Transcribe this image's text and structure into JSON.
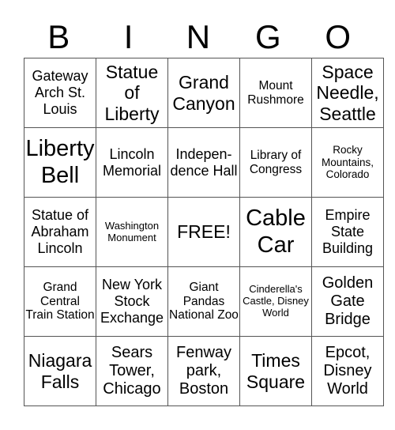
{
  "header": {
    "letters": [
      "B",
      "I",
      "N",
      "G",
      "O"
    ]
  },
  "grid": {
    "rows": [
      [
        "Gateway Arch St. Louis",
        "Statue of Liberty",
        "Grand Canyon",
        "Mount Rushmore",
        "Space Needle, Seattle"
      ],
      [
        "Liberty Bell",
        "Lincoln Memorial",
        "Indepen-dence Hall",
        "Library of Congress",
        "Rocky Mountains, Colorado"
      ],
      [
        "Statue of Abraham Lincoln",
        "Washington Monument",
        "FREE!",
        "Cable Car",
        "Empire State Building"
      ],
      [
        "Grand Central Train Station",
        "New York Stock Exchange",
        "Giant Pandas National Zoo",
        "Cinderella's Castle, Disney World",
        "Golden Gate Bridge"
      ],
      [
        "Niagara Falls",
        "Sears Tower, Chicago",
        "Fenway park, Boston",
        "Times Square",
        "Epcot, Disney World"
      ]
    ]
  }
}
